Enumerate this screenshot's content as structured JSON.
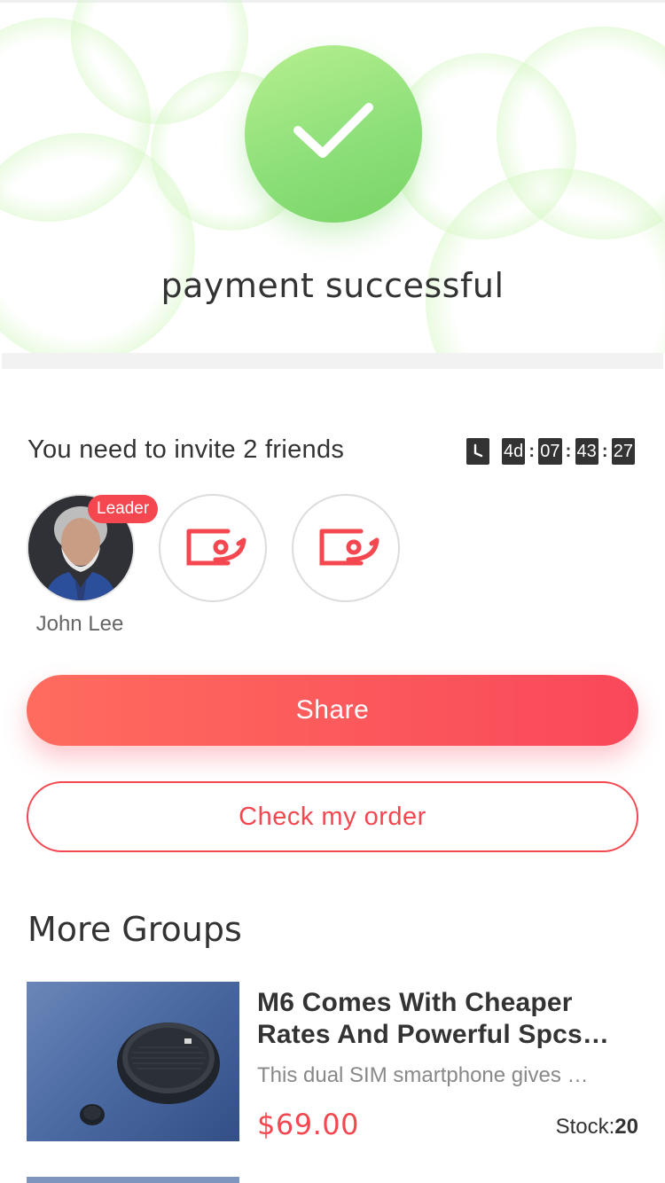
{
  "status": {
    "title": "payment successful",
    "icon": "checkmark-icon",
    "accent": "#8ee07a"
  },
  "invite": {
    "text": "You need to invite 2 friends",
    "timer": {
      "icon": "clock-icon",
      "days": "4d",
      "hours": "07",
      "minutes": "43",
      "seconds": "27"
    },
    "leader": {
      "badge": "Leader",
      "name": "John Lee"
    },
    "empty_slots": [
      "coupon-tag-icon",
      "coupon-tag-icon"
    ]
  },
  "actions": {
    "share_label": "Share",
    "order_label": "Check my order",
    "accent": "#f4474f"
  },
  "more_groups": {
    "title": "More Groups",
    "items": [
      {
        "name_line1": "M6 Comes With Cheaper",
        "name_line2": "Rates And Powerful Spcs…",
        "description": "This dual SIM smartphone gives …",
        "price": "$69.00",
        "stock_label": "Stock:",
        "stock_value": "20"
      }
    ]
  }
}
